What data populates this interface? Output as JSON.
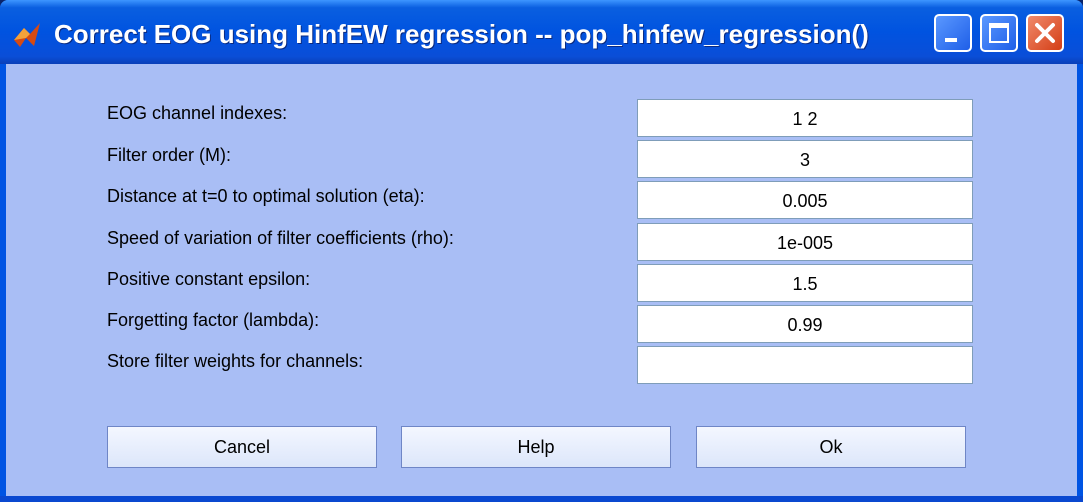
{
  "window": {
    "title": "Correct EOG using HinfEW regression -- pop_hinfew_regression()",
    "colors": {
      "titlebar": "#0054e3",
      "client": "#a9bef5",
      "close": "#d43e16"
    },
    "icons": {
      "app": "matlab-icon",
      "minimize": "minimize-icon",
      "maximize": "maximize-icon",
      "close": "close-icon"
    }
  },
  "form": {
    "fields": [
      {
        "label": "EOG channel indexes:",
        "value": "1 2"
      },
      {
        "label": "Filter order (M):",
        "value": "3"
      },
      {
        "label": "Distance at t=0 to optimal solution (eta):",
        "value": "0.005"
      },
      {
        "label": "Speed of variation of filter coefficients (rho):",
        "value": "1e-005"
      },
      {
        "label": "Positive constant epsilon:",
        "value": "1.5"
      },
      {
        "label": "Forgetting factor (lambda):",
        "value": "0.99"
      },
      {
        "label": "Store filter weights for channels:",
        "value": ""
      }
    ]
  },
  "buttons": {
    "cancel": "Cancel",
    "help": "Help",
    "ok": "Ok"
  }
}
